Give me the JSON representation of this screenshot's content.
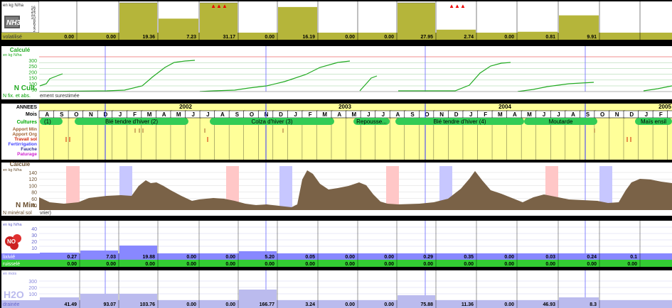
{
  "units": {
    "kg_n_ha": "en kg N/ha",
    "calcule": "Calculé",
    "en_mois": "en mois"
  },
  "nh3": {
    "symbol": "NH3",
    "row_label": "volatilisé",
    "scale_ticks": [
      "16",
      "14",
      "12",
      "10",
      "8",
      "6",
      "4",
      "2"
    ],
    "bars_percent": [
      0,
      0,
      100,
      47,
      100,
      0,
      86,
      0,
      0,
      100,
      10,
      0,
      3,
      58
    ],
    "warning_markers": [
      "▲▲▲",
      "▲▲▲"
    ],
    "values": [
      "0.00",
      "0.00",
      "19.36",
      "7.23",
      "31.17",
      "0.00",
      "16.19",
      "0.00",
      "0.00",
      "27.95",
      "2.74",
      "0.00",
      "0.81",
      "9.91"
    ]
  },
  "ncult": {
    "title": "Calculé",
    "unit": "en kg N/ha",
    "ticks": [
      "300",
      "250",
      "200",
      "150",
      "100",
      "50"
    ],
    "label": "N Cult.",
    "footer": "N fix. et abs.",
    "footer_note": "ement surestimée"
  },
  "calendar": {
    "row_annees": "ANNEES",
    "row_mois": "Mois",
    "row_cultures": "Cultures",
    "legend": [
      "Apport Min",
      "Apport Org",
      "Travail sol",
      "Fertirrigation",
      "Fauche",
      "Paturage"
    ],
    "years": [
      "2002",
      "2003",
      "2004",
      "2005"
    ],
    "months": [
      "A",
      "S",
      "O",
      "N",
      "D",
      "J",
      "F",
      "M",
      "A",
      "M",
      "J",
      "J",
      "A",
      "S",
      "O",
      "N",
      "D",
      "J",
      "F",
      "M",
      "A",
      "M",
      "J",
      "J",
      "A",
      "S",
      "O",
      "N",
      "D",
      "J",
      "F",
      "M",
      "A",
      "M",
      "J",
      "J",
      "A",
      "S",
      "O",
      "N",
      "D",
      "J",
      "F",
      "M"
    ],
    "crops": [
      "(1)",
      "Blé tendre d'hiver (2)",
      "Colza d'hiver (3)",
      "Repousse...",
      "Blé tendre d'hiver (4)",
      "Moutarde",
      "Maïs ensil"
    ]
  },
  "nmin": {
    "title": "Calculé",
    "unit": "en kg N/ha",
    "ticks": [
      "140",
      "120",
      "100",
      "80",
      "60",
      "40",
      "20"
    ],
    "label": "N Min.",
    "footer": "N minéral sol",
    "footer_note": "vrier)"
  },
  "no3": {
    "unit": "en kg N/ha",
    "ticks": [
      "40",
      "30",
      "20",
      "10"
    ],
    "row_lixivie": "lixivié",
    "row_ruissele": "ruisselé",
    "lixivie": [
      "0.27",
      "7.03",
      "19.88",
      "0.00",
      "0.00",
      "5.20",
      "0.05",
      "0.00",
      "0.00",
      "0.29",
      "0.35",
      "0.00",
      "0.03",
      "0.24",
      "0.1"
    ],
    "ruissele": [
      "0.00",
      "0.00",
      "0.00",
      "0.00",
      "0.00",
      "0.00",
      "0.00",
      "0.00",
      "0.00",
      "0.00",
      "0.00",
      "0.00",
      "0.00",
      "0.00",
      "0.00"
    ]
  },
  "h2o": {
    "symbol": "H2O",
    "unit": "en mois",
    "ticks": [
      "300",
      "200",
      "100"
    ],
    "row_draine": "drainée",
    "draine": [
      "41.49",
      "93.07",
      "103.76",
      "0.00",
      "0.00",
      "166.77",
      "3.24",
      "0.00",
      "0.00",
      "75.88",
      "11.36",
      "0.00",
      "46.93",
      "8.3"
    ]
  },
  "colors": {
    "olive": "#b5b53a",
    "green": "#22aa22",
    "brown": "#7a6247",
    "crop": "#33cc55",
    "calendar": "#ffff99",
    "lixivie_bar": "#8888ff",
    "ruissele_bar": "#33cc33",
    "pink": "#ffc7c7",
    "lavender": "#c7c7ff"
  }
}
